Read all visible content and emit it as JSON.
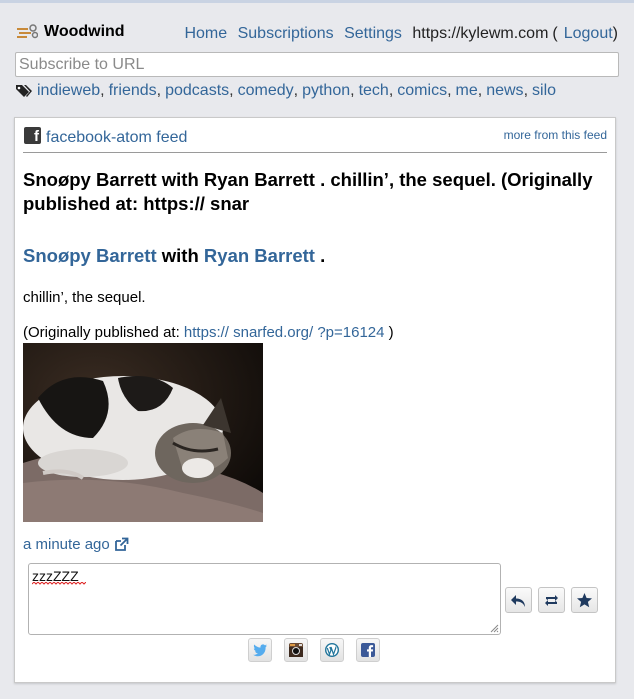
{
  "header": {
    "brand": "Woodwind",
    "nav": {
      "home": "Home",
      "subscriptions": "Subscriptions",
      "settings": "Settings"
    },
    "user_url": "https://kylewm.com",
    "open_paren": "(",
    "logout": "Logout",
    "close_paren": ")"
  },
  "subscribe": {
    "placeholder": "Subscribe to URL",
    "value": ""
  },
  "tags": [
    "indieweb",
    "friends",
    "podcasts",
    "comedy",
    "python",
    "tech",
    "comics",
    "me",
    "news",
    "silo"
  ],
  "feed": {
    "name": "facebook-atom feed",
    "more_link": "more from this feed"
  },
  "entry": {
    "title": "Snoøpy Barrett with Ryan Barrett . chillin’, the sequel. (Originally published at: https:// snar",
    "h2_link1": "Snoøpy Barrett",
    "h2_with": " with ",
    "h2_link2": "Ryan Barrett",
    "h2_end": " .",
    "paragraph": "chillin’, the sequel.",
    "pub_prefix": "(Originally published at: ",
    "pub_link": "https:// snarfed.org/ ?p=16124",
    "pub_suffix": " )",
    "time": "a minute ago"
  },
  "reply": {
    "value": "zzzZZZ"
  },
  "actions": [
    "reply-icon",
    "retweet-icon",
    "star-icon"
  ],
  "silos": [
    "twitter-icon",
    "instagram-icon",
    "wordpress-icon",
    "facebook-icon"
  ],
  "colors": {
    "link": "#336699",
    "background": "#e8e9ed",
    "brand_accent": "#c88a3a"
  }
}
